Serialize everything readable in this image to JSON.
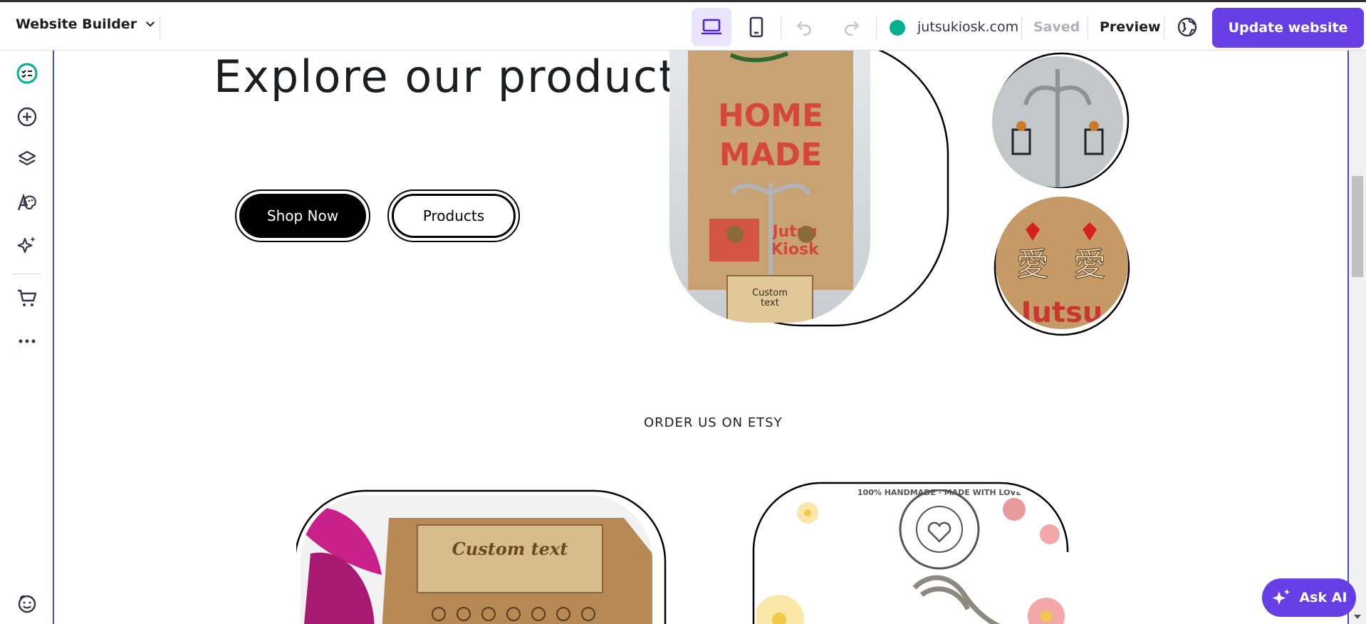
{
  "topbar": {
    "brand_label": "Website Builder",
    "domain": "jutsukiosk.com",
    "domain_status_color": "#00b090",
    "saved_label": "Saved",
    "preview_label": "Preview",
    "update_label": "Update website",
    "accent_color": "#673de6",
    "icons": [
      "chevron-down-icon",
      "desktop-icon",
      "mobile-icon",
      "undo-icon",
      "redo-icon",
      "globe-icon"
    ]
  },
  "sidebar": {
    "items": [
      "checklist-icon",
      "add-icon",
      "layers-icon",
      "styles-icon",
      "ai-tools-icon",
      "store-icon",
      "more-icon",
      "help-icon"
    ]
  },
  "page": {
    "hero_title": "Explore our products",
    "shop_now_label": "Shop Now",
    "products_label": "Products",
    "section_label": "ORDER US ON ETSY",
    "photo_box_text": "Custom text",
    "bag_text_top": "HOME MADE",
    "bag_text_bottom": "Jutsu Kiosk",
    "earring_bg_text": "Jutsu",
    "stamp_text": "100% HANDMADE · MADE WITH LOVE"
  },
  "askai": {
    "label": "Ask AI"
  }
}
